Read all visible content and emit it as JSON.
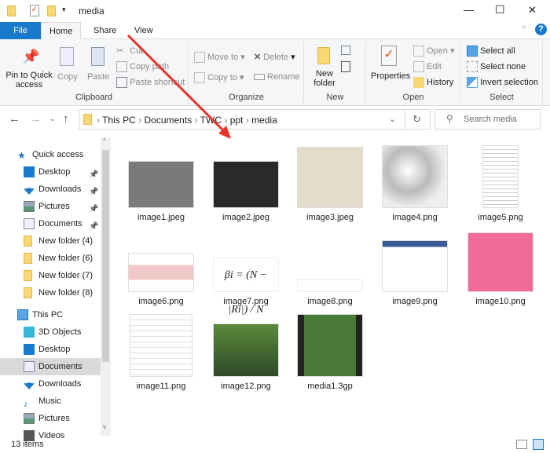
{
  "window": {
    "title": "media",
    "controls": {
      "minimize": "—",
      "maximize": "☐",
      "close": "✕"
    }
  },
  "tabs": {
    "file": "File",
    "home": "Home",
    "share": "Share",
    "view": "View",
    "help": "?"
  },
  "ribbon": {
    "clipboard": {
      "label": "Clipboard",
      "pin": "Pin to Quick access",
      "copy": "Copy",
      "paste": "Paste",
      "cut": "Cut",
      "copy_path": "Copy path",
      "paste_shortcut": "Paste shortcut"
    },
    "organize": {
      "label": "Organize",
      "move_to": "Move to",
      "copy_to": "Copy to",
      "delete": "Delete",
      "rename": "Rename"
    },
    "new": {
      "label": "New",
      "new_folder": "New folder"
    },
    "open": {
      "label": "Open",
      "properties": "Properties",
      "open": "Open",
      "edit": "Edit",
      "history": "History"
    },
    "select": {
      "label": "Select",
      "select_all": "Select all",
      "select_none": "Select none",
      "invert": "Invert selection"
    }
  },
  "address": {
    "crumbs": [
      "This PC",
      "Documents",
      "TWC",
      "ppt",
      "media"
    ],
    "search_placeholder": "Search media"
  },
  "nav": {
    "quick_access": "Quick access",
    "quick": [
      {
        "label": "Desktop",
        "pinned": true
      },
      {
        "label": "Downloads",
        "pinned": true
      },
      {
        "label": "Pictures",
        "pinned": true
      },
      {
        "label": "Documents",
        "pinned": true
      },
      {
        "label": "New folder (4)"
      },
      {
        "label": "New folder (6)"
      },
      {
        "label": "New folder (7)"
      },
      {
        "label": "New folder (8)"
      }
    ],
    "this_pc": "This PC",
    "pc": [
      {
        "label": "3D Objects"
      },
      {
        "label": "Desktop"
      },
      {
        "label": "Documents",
        "selected": true
      },
      {
        "label": "Downloads"
      },
      {
        "label": "Music"
      },
      {
        "label": "Pictures"
      },
      {
        "label": "Videos"
      }
    ]
  },
  "files": [
    {
      "name": "image1.jpeg"
    },
    {
      "name": "image2.jpeg"
    },
    {
      "name": "image3.jpeg"
    },
    {
      "name": "image4.png"
    },
    {
      "name": "image5.png"
    },
    {
      "name": "image6.png"
    },
    {
      "name": "image7.png",
      "formula": "βi = (N − |Ri|) / N"
    },
    {
      "name": "image8.png"
    },
    {
      "name": "image9.png"
    },
    {
      "name": "image10.png"
    },
    {
      "name": "image11.png"
    },
    {
      "name": "image12.png"
    },
    {
      "name": "media1.3gp"
    }
  ],
  "status": {
    "count": "13 items"
  },
  "colors": {
    "accent": "#1979ca",
    "arrow": "#e8322a"
  }
}
